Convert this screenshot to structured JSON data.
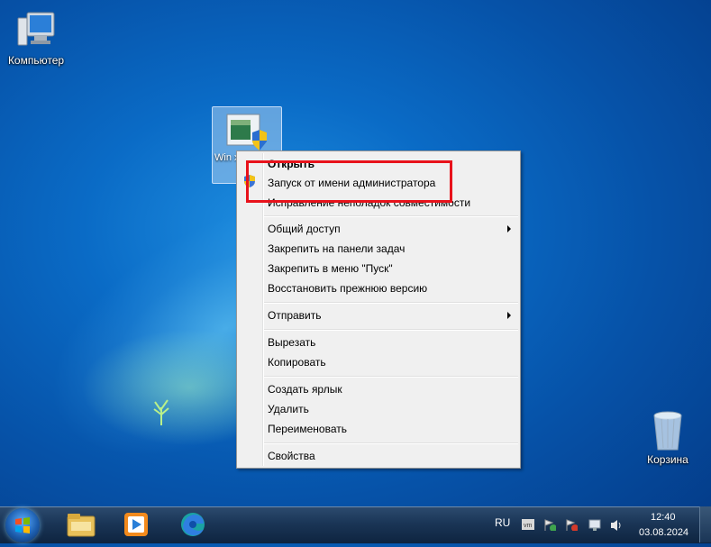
{
  "desktop": {
    "icons": [
      {
        "label": "Компьютер",
        "icon": "computer-icon"
      },
      {
        "label": "Корзина",
        "icon": "recycle-bin-icon"
      }
    ],
    "selected_file": {
      "label": "Win x64 (",
      "icon": "installer-shield-icon"
    }
  },
  "context_menu": {
    "items": [
      {
        "label": "Открыть",
        "bold": true
      },
      {
        "label": "Запуск от имени администратора",
        "icon": "uac-shield-icon"
      },
      {
        "label": "Исправление неполадок совместимости"
      },
      {
        "label": "Общий доступ",
        "submenu": true
      },
      {
        "label": "Закрепить на панели задач"
      },
      {
        "label": "Закрепить в меню \"Пуск\""
      },
      {
        "label": "Восстановить прежнюю версию"
      },
      {
        "label": "Отправить",
        "submenu": true
      },
      {
        "label": "Вырезать"
      },
      {
        "label": "Копировать"
      },
      {
        "label": "Создать ярлык"
      },
      {
        "label": "Удалить"
      },
      {
        "label": "Переименовать"
      },
      {
        "label": "Свойства"
      }
    ],
    "highlight_color": "#e8121b"
  },
  "taskbar": {
    "pinned": [
      "start-button",
      "explorer-icon",
      "media-player-icon",
      "edge-icon"
    ],
    "language": "RU",
    "time": "12:40",
    "date": "03.08.2024",
    "tray_icons": [
      "vmware-icon",
      "action-center-icon",
      "flag-icon",
      "network-icon",
      "volume-icon"
    ]
  }
}
